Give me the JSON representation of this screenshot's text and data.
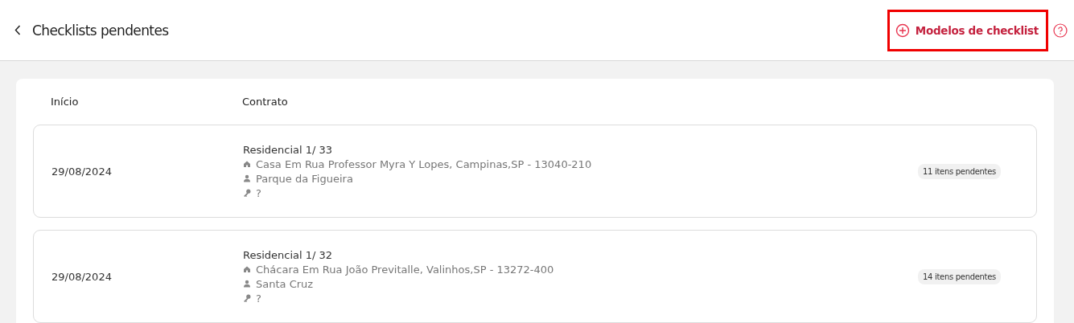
{
  "header": {
    "title": "Checklists pendentes",
    "action": {
      "label": "Modelos de checklist",
      "highlighted": true
    }
  },
  "table": {
    "columns": [
      "Início",
      "Contrato"
    ],
    "rows": [
      {
        "date": "29/08/2024",
        "contract": "Residencial 1/ 33",
        "address": "Casa Em Rua Professor Myra Y Lopes, Campinas,SP - 13040-210",
        "owner": "Parque da Figueira",
        "key": "?",
        "badge": "11 itens pendentes"
      },
      {
        "date": "29/08/2024",
        "contract": "Residencial 1/ 32",
        "address": "Chácara Em Rua João Previtalle, Valinhos,SP - 13272-400",
        "owner": "Santa Cruz",
        "key": "?",
        "badge": "14 itens pendentes"
      }
    ]
  }
}
